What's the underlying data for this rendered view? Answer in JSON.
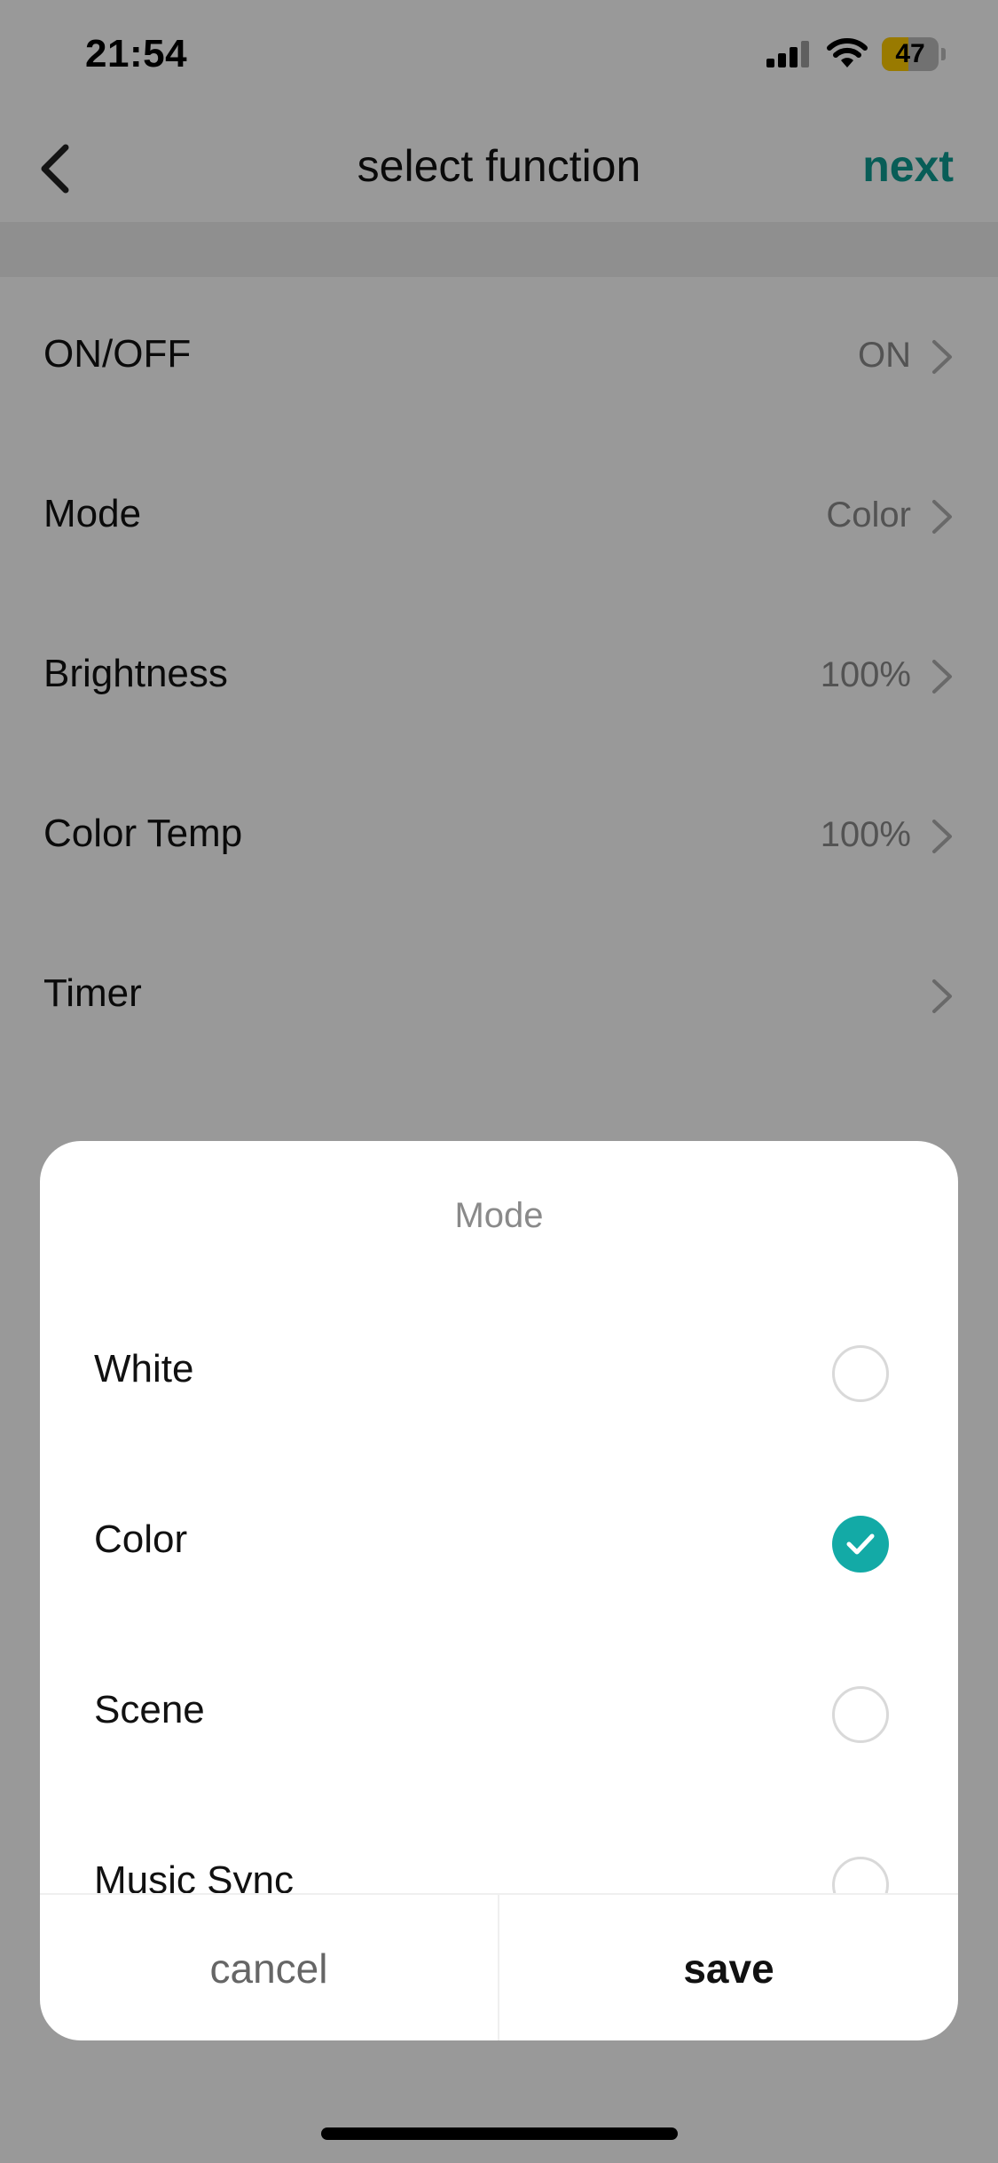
{
  "status_bar": {
    "time": "21:54",
    "battery_level": "47",
    "battery_fraction": 0.47,
    "battery_color": "#ffcc00"
  },
  "nav": {
    "title": "select function",
    "next_label": "next",
    "accent_color": "#0e9c91",
    "back_icon": "chevron-left-icon"
  },
  "functions": [
    {
      "label": "ON/OFF",
      "value": "ON"
    },
    {
      "label": "Mode",
      "value": "Color"
    },
    {
      "label": "Brightness",
      "value": "100%"
    },
    {
      "label": "Color Temp",
      "value": "100%"
    },
    {
      "label": "Timer",
      "value": ""
    }
  ],
  "sheet": {
    "title": "Mode",
    "selected_color": "#13aaa6",
    "options": [
      {
        "label": "White",
        "selected": false
      },
      {
        "label": "Color",
        "selected": true
      },
      {
        "label": "Scene",
        "selected": false
      },
      {
        "label": "Music Sync",
        "selected": false
      }
    ],
    "cancel_label": "cancel",
    "save_label": "save"
  }
}
